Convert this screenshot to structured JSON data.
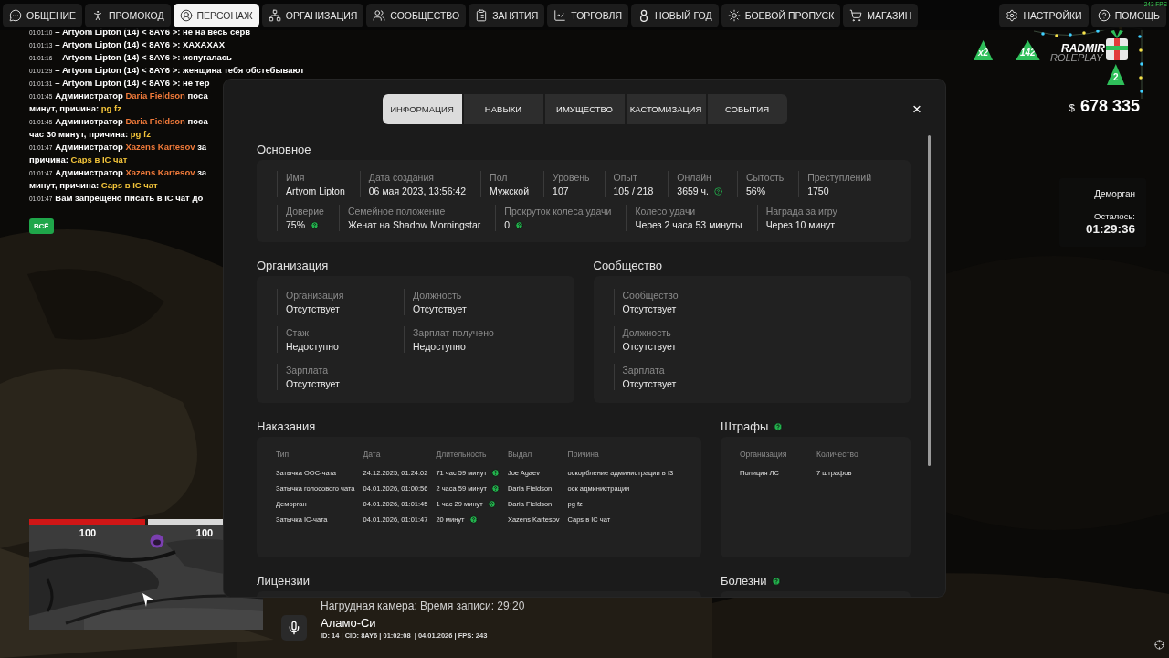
{
  "top_nav": {
    "left": [
      {
        "label": "ОБЩЕНИЕ",
        "selected": false
      },
      {
        "label": "ПРОМОКОД",
        "selected": false
      },
      {
        "label": "ПЕРСОНАЖ",
        "selected": true
      },
      {
        "label": "ОРГАНИЗАЦИЯ",
        "selected": false
      },
      {
        "label": "СООБЩЕСТВО",
        "selected": false
      },
      {
        "label": "ЗАНЯТИЯ",
        "selected": false
      },
      {
        "label": "ТОРГОВЛЯ",
        "selected": false
      },
      {
        "label": "НОВЫЙ ГОД",
        "selected": false
      },
      {
        "label": "БОЕВОЙ ПРОПУСК",
        "selected": false
      },
      {
        "label": "МАГАЗИН",
        "selected": false
      }
    ],
    "right": [
      {
        "label": "НАСТРОЙКИ",
        "selected": false
      },
      {
        "label": "ПОМОЩЬ",
        "selected": false
      }
    ]
  },
  "fps": "243 FPS",
  "chat": {
    "messages": [
      {
        "time": "01:01:10",
        "parts": [
          {
            "kind": "plain",
            "text": "– Artyom Lipton (14) < 8AY6 >: не на весь серв"
          }
        ]
      },
      {
        "time": "01:01:13",
        "parts": [
          {
            "kind": "plain",
            "text": "– Artyom Lipton (14) < 8AY6 >: XAXAXAX"
          }
        ]
      },
      {
        "time": "01:01:16",
        "parts": [
          {
            "kind": "plain",
            "text": "– Artyom Lipton (14) < 8AY6 >: испугалась"
          }
        ]
      },
      {
        "time": "01:01:29",
        "parts": [
          {
            "kind": "plain",
            "text": "– Artyom Lipton (14) < 8AY6 >: женщина тебя обстебывают"
          }
        ]
      },
      {
        "time": "01:01:31",
        "parts": [
          {
            "kind": "plain",
            "text": "– Artyom Lipton (14) < 8AY6 >: не тер"
          }
        ]
      },
      {
        "time": "01:01:45",
        "parts": [
          {
            "kind": "plain",
            "text": "Администратор "
          },
          {
            "kind": "name",
            "text": "Daria Fieldson"
          },
          {
            "kind": "plain",
            "text": " поса"
          }
        ],
        "wrap": [
          {
            "kind": "plain",
            "text": "минут, причина: "
          },
          {
            "kind": "reason",
            "text": "pg fz"
          }
        ]
      },
      {
        "time": "01:01:45",
        "parts": [
          {
            "kind": "plain",
            "text": "Администратор "
          },
          {
            "kind": "name",
            "text": "Daria Fieldson"
          },
          {
            "kind": "plain",
            "text": " поса"
          }
        ],
        "wrap": [
          {
            "kind": "plain",
            "text": "час 30 минут, причина: "
          },
          {
            "kind": "reason",
            "text": "pg fz"
          }
        ]
      },
      {
        "time": "01:01:47",
        "parts": [
          {
            "kind": "plain",
            "text": "Администратор "
          },
          {
            "kind": "name",
            "text": "Xazens Kartesov"
          },
          {
            "kind": "plain",
            "text": " за"
          }
        ],
        "wrap": [
          {
            "kind": "plain",
            "text": "причина: "
          },
          {
            "kind": "reason",
            "text": "Caps в IC чат"
          }
        ]
      },
      {
        "time": "01:01:47",
        "parts": [
          {
            "kind": "plain",
            "text": "Администратор "
          },
          {
            "kind": "name",
            "text": "Xazens Kartesov"
          },
          {
            "kind": "plain",
            "text": " за"
          }
        ],
        "wrap": [
          {
            "kind": "plain",
            "text": "минут, причина: "
          },
          {
            "kind": "reason",
            "text": "Caps в IC чат"
          }
        ]
      },
      {
        "time": "01:01:47",
        "parts": [
          {
            "kind": "plain",
            "text": "Вам запрещено писать в IC чат до"
          }
        ]
      }
    ],
    "filter_button": "ВСЁ"
  },
  "hud": {
    "logo": {
      "title": "RADMIR",
      "subtitle": "ROLEPLAY"
    },
    "badges": [
      "x2",
      "142"
    ],
    "gift_count": "2",
    "money": {
      "currency": "$",
      "amount": "678 335"
    },
    "jail": {
      "title": "Деморган",
      "remaining_label": "Осталось:",
      "time": "01:29:36"
    }
  },
  "minimap": {
    "health": {
      "value": "100",
      "level": 1
    },
    "armor": {
      "value": "100",
      "level": 1
    }
  },
  "voice": {
    "camera": "Нагрудная камера: Время записи: 29:20",
    "location": "Аламо-Си",
    "info": "ID: 14 | CID: 8AY6 | 01:02:08  | 04.01.2026 | FPS: 243"
  },
  "dialog": {
    "tabs": [
      {
        "label": "ИНФОРМАЦИЯ",
        "selected": true
      },
      {
        "label": "НАВЫКИ",
        "selected": false
      },
      {
        "label": "ИМУЩЕСТВО",
        "selected": false
      },
      {
        "label": "КАСТОМИЗАЦИЯ",
        "selected": false
      },
      {
        "label": "СОБЫТИЯ",
        "selected": false
      }
    ],
    "close": "×",
    "basic": {
      "title": "Основное",
      "rows": [
        {
          "fields": [
            {
              "label": "Имя",
              "value": "Artyom Lipton"
            },
            {
              "label": "Дата создания",
              "value": "06 мая 2023, 13:56:42"
            },
            {
              "label": "Пол",
              "value": "Мужской"
            },
            {
              "label": "Уровень",
              "value": "107"
            },
            {
              "label": "Опыт",
              "value": "105 / 218"
            },
            {
              "label": "Онлайн",
              "value": "3659 ч.",
              "help": true,
              "help_filled": false
            },
            {
              "label": "Сытость",
              "value": "56%"
            },
            {
              "label": "Преступлений",
              "value": "1750"
            }
          ]
        },
        {
          "fields": [
            {
              "label": "Доверие",
              "value": "75%",
              "help": true,
              "help_filled": true
            },
            {
              "label": "Семейное положение",
              "value": "Женат на Shadow Morningstar"
            },
            {
              "label": "Прокруток колеса удачи",
              "value": "0",
              "help": true,
              "help_filled": true
            },
            {
              "label": "Колесо удачи",
              "value": "Через 2 часа 53 минуты"
            },
            {
              "label": "Награда за игру",
              "value": "Через 10 минут"
            }
          ]
        }
      ]
    },
    "organization": {
      "title": "Организация",
      "columns": [
        [
          {
            "label": "Организация",
            "value": "Отсутствует"
          },
          {
            "label": "Стаж",
            "value": "Недоступно"
          },
          {
            "label": "Зарплата",
            "value": "Отсутствует"
          }
        ],
        [
          {
            "label": "Должность",
            "value": "Отсутствует"
          },
          {
            "label": "Зарплат получено",
            "value": "Недоступно"
          }
        ]
      ]
    },
    "community": {
      "title": "Сообщество",
      "columns": [
        [
          {
            "label": "Сообщество",
            "value": "Отсутствует"
          },
          {
            "label": "Должность",
            "value": "Отсутствует"
          },
          {
            "label": "Зарплата",
            "value": "Отсутствует"
          }
        ]
      ]
    },
    "punishments": {
      "title": "Наказания",
      "columns": [
        "Тип",
        "Дата",
        "Длительность",
        "Выдал",
        "Причина"
      ],
      "rows": [
        [
          "Затычка ООС-чата",
          "24.12.2025, 01:24:02",
          "71 час 59 минут",
          "Joe Agaev",
          "оскорбление администрации в f3"
        ],
        [
          "Затычка голосового чата",
          "04.01.2026, 01:00:56",
          "2 часа 59 минут",
          "Daria Fieldson",
          "оск администрации"
        ],
        [
          "Деморган",
          "04.01.2026, 01:01:45",
          "1 час 29 минут",
          "Daria Fieldson",
          "pg fz"
        ],
        [
          "Затычка IC-чата",
          "04.01.2026, 01:01:47",
          "20 минут",
          "Xazens Kartesov",
          "Caps в IC чат"
        ]
      ]
    },
    "fines": {
      "title": "Штрафы",
      "help": true,
      "columns": [
        "Организация",
        "Количество"
      ],
      "rows": [
        [
          "Полиция ЛС",
          "7 штрафов"
        ]
      ]
    },
    "licenses": {
      "title": "Лицензии"
    },
    "diseases": {
      "title": "Болезни",
      "help": true
    }
  }
}
